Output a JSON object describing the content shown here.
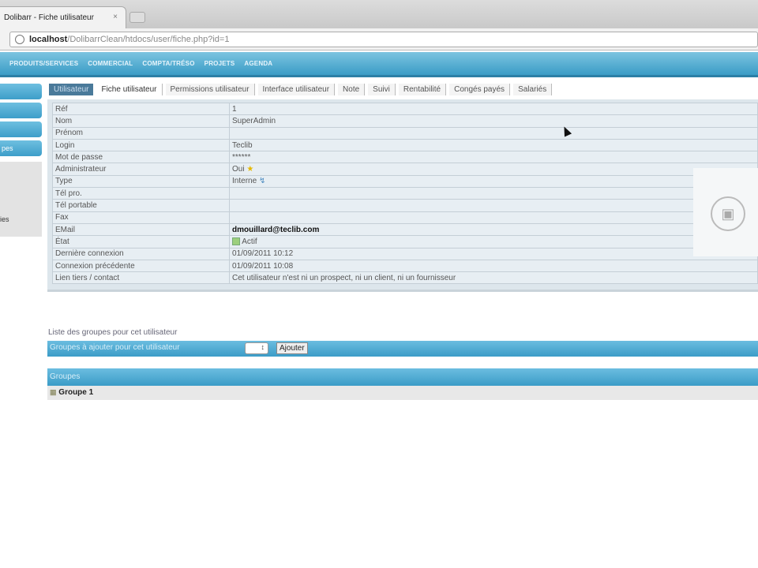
{
  "browser": {
    "tab_title": "Dolibarr - Fiche utilisateur",
    "tab_close": "×",
    "url_host": "localhost",
    "url_path": "/DolibarrClean/htdocs/user/fiche.php?id=1"
  },
  "nav": {
    "items": [
      "PRODUITS/SERVICES",
      "COMMERCIAL",
      "COMPTA/TRÉSO",
      "PROJETS",
      "AGENDA"
    ]
  },
  "sidebar": {
    "items": [
      "",
      "",
      "",
      "pes"
    ],
    "sub": "ies"
  },
  "tabs": {
    "head": "Utilisateur",
    "items": [
      "Fiche utilisateur",
      "Permissions utilisateur",
      "Interface utilisateur",
      "Note",
      "Suivi",
      "Rentabilité",
      "Congés payés",
      "Salariés"
    ]
  },
  "fields": [
    {
      "label": "Réf",
      "value": "1"
    },
    {
      "label": "Nom",
      "value": "SuperAdmin"
    },
    {
      "label": "Prénom",
      "value": ""
    },
    {
      "label": "Login",
      "value": "Teclib"
    },
    {
      "label": "Mot de passe",
      "value": "******"
    },
    {
      "label": "Administrateur",
      "value": "Oui"
    },
    {
      "label": "Type",
      "value": "Interne"
    },
    {
      "label": "Tél pro.",
      "value": ""
    },
    {
      "label": "Tél portable",
      "value": ""
    },
    {
      "label": "Fax",
      "value": ""
    },
    {
      "label": "EMail",
      "value": "dmouillard@teclib.com"
    },
    {
      "label": "État",
      "value": "Actif"
    },
    {
      "label": "Dernière connexion",
      "value": "01/09/2011 10:12"
    },
    {
      "label": "Connexion précédente",
      "value": "01/09/2011 10:08"
    },
    {
      "label": "Lien tiers / contact",
      "value": "Cet utilisateur n'est ni un prospect, ni un client, ni un fournisseur"
    }
  ],
  "groups": {
    "list_title": "Liste des groupes pour cet utilisateur",
    "add_label": "Groupes à ajouter pour cet utilisateur",
    "add_button": "Ajouter",
    "header": "Groupes",
    "rows": [
      "Groupe 1"
    ]
  }
}
